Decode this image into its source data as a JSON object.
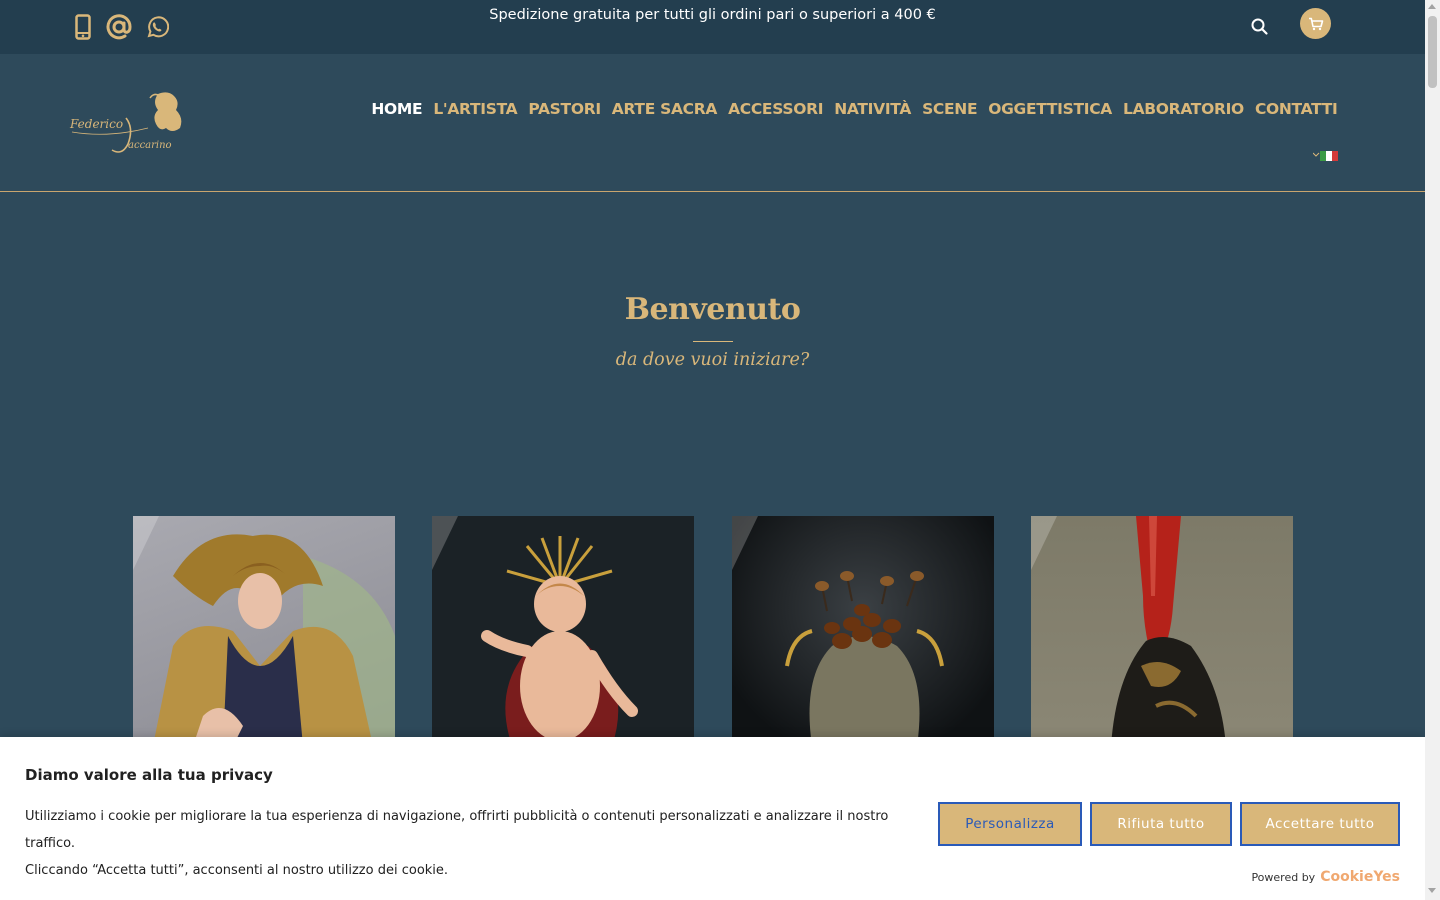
{
  "topbar": {
    "promo": "Spedizione gratuita per tutti gli ordini pari o superiori a 400 €",
    "icons": [
      "phone-icon",
      "at-icon",
      "whatsapp-icon"
    ],
    "search_icon": "search-icon",
    "cart_icon": "cart-icon"
  },
  "header": {
    "logo_alt": "Federico Iaccarino",
    "nav": [
      "HOME",
      "L'ARTISTA",
      "PASTORI",
      "ARTE SACRA",
      "ACCESSORI",
      "NATIVITÀ",
      "SCENE",
      "OGGETTISTICA",
      "LABORATORIO",
      "CONTATTI"
    ],
    "active_nav": "HOME",
    "language": "it-flag-icon"
  },
  "hero": {
    "title": "Benvenuto",
    "subtitle": "da dove vuoi iniziare?"
  },
  "tiles": [
    {
      "name": "angel-figure"
    },
    {
      "name": "baby-jesus-figure"
    },
    {
      "name": "chestnut-basket"
    },
    {
      "name": "red-horn"
    }
  ],
  "cookie": {
    "title": "Diamo valore alla tua privacy",
    "text_line1": "Utilizziamo i cookie per migliorare la tua esperienza di navigazione, offrirti pubblicità o contenuti personalizzati e analizzare il nostro traffico.",
    "text_line2": "Cliccando “Accetta tutti”, acconsenti al nostro utilizzo dei cookie.",
    "btn_customize": "Personalizza",
    "btn_reject": "Rifiuta tutto",
    "btn_accept": "Accettare tutto",
    "powered_by": "Powered by",
    "brand": "CookieYes"
  },
  "colors": {
    "accent": "#d9b77a",
    "bg": "#2e4a5b",
    "topbar": "#233e4f",
    "btn_border": "#2a5ab8"
  }
}
